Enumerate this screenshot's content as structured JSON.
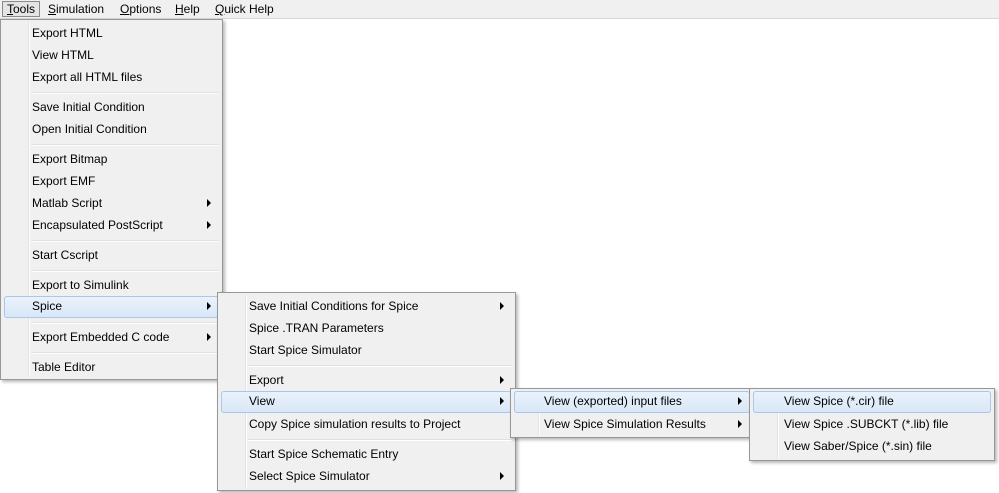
{
  "menubar": {
    "items": [
      {
        "label": "Tools",
        "mnemonic": "T",
        "rest": "ools"
      },
      {
        "label": "Simulation",
        "mnemonic": "S",
        "rest": "imulation"
      },
      {
        "label": "Options",
        "mnemonic": "O",
        "rest": "ptions"
      },
      {
        "label": "Help",
        "mnemonic": "H",
        "rest": "elp"
      },
      {
        "label": "Quick Help",
        "mnemonic": "Q",
        "rest": "uick Help"
      }
    ]
  },
  "tools_menu": {
    "items": [
      {
        "label": "Export HTML"
      },
      {
        "label": "View HTML"
      },
      {
        "label": "Export all HTML files"
      },
      {
        "label": "Save Initial Condition"
      },
      {
        "label": "Open Initial Condition"
      },
      {
        "label": "Export Bitmap"
      },
      {
        "label": "Export EMF"
      },
      {
        "label": "Matlab Script",
        "submenu": true
      },
      {
        "label": "Encapsulated PostScript",
        "submenu": true
      },
      {
        "label": "Start Cscript"
      },
      {
        "label": "Export to Simulink"
      },
      {
        "label": "Spice",
        "submenu": true,
        "highlighted": true
      },
      {
        "label": "Export Embedded C code",
        "submenu": true
      },
      {
        "label": "Table Editor"
      }
    ]
  },
  "spice_menu": {
    "items": [
      {
        "label": "Save Initial Conditions for Spice",
        "submenu": true
      },
      {
        "label": "Spice .TRAN Parameters"
      },
      {
        "label": "Start Spice Simulator"
      },
      {
        "label": "Export",
        "submenu": true
      },
      {
        "label": "View",
        "submenu": true,
        "highlighted": true
      },
      {
        "label": "Copy Spice simulation results to Project"
      },
      {
        "label": "Start Spice Schematic Entry"
      },
      {
        "label": "Select Spice Simulator",
        "submenu": true
      }
    ]
  },
  "view_menu": {
    "items": [
      {
        "label": "View (exported) input files",
        "submenu": true,
        "highlighted": true
      },
      {
        "label": "View Spice Simulation Results",
        "submenu": true
      }
    ]
  },
  "input_files_menu": {
    "items": [
      {
        "label": "View Spice (*.cir) file",
        "highlighted": true
      },
      {
        "label": "View Spice .SUBCKT (*.lib) file"
      },
      {
        "label": "View Saber/Spice (*.sin) file"
      }
    ]
  },
  "colors": {
    "menu_bg": "#f0f0f0",
    "highlight_bg": "#dce9f7",
    "highlight_border": "#a8c7ea",
    "menu_border": "#979797"
  }
}
